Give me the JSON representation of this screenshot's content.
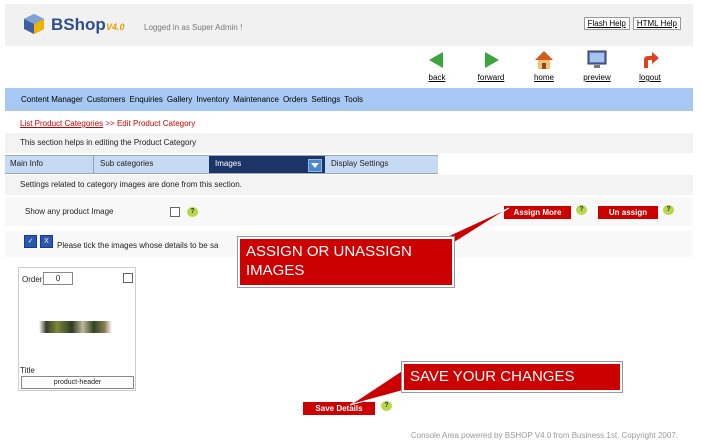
{
  "app": {
    "name": "BShop",
    "version": "V4.0",
    "logged_in": "Logged in as Super Admin !"
  },
  "top_links": [
    "Flash Help",
    "HTML Help"
  ],
  "nav_buttons": [
    {
      "label": "back",
      "icon": "back-arrow-icon"
    },
    {
      "label": "forward",
      "icon": "forward-arrow-icon"
    },
    {
      "label": "home",
      "icon": "home-icon"
    },
    {
      "label": "preview",
      "icon": "preview-monitor-icon"
    },
    {
      "label": "logout",
      "icon": "logout-arrow-icon"
    }
  ],
  "menu": [
    "Content Manager",
    "Customers",
    "Enquiries",
    "Gallery",
    "Inventory",
    "Maintenance",
    "Orders",
    "Settings",
    "Tools"
  ],
  "breadcrumb": {
    "link": "List Product Categories",
    "sep": " >> ",
    "current": "Edit Product Category"
  },
  "section_desc": "This section helps in editing the Product Category",
  "tabs": [
    "Main Info",
    "Sub categories",
    "Images",
    "Display Settings"
  ],
  "active_tab": "Images",
  "info_line": "Settings related to category images are done from this section.",
  "show_any_label": "Show any product Image",
  "help_glyph": "?",
  "buttons": {
    "assign_more": "Assign More",
    "unassign": "Un assign",
    "save_details": "Save Details",
    "check_all": "✓",
    "uncheck_all": "X"
  },
  "tick_text": "Please tick the images whose details to be sa",
  "image_card": {
    "order_label": "Order",
    "order_value": "0",
    "title_label": "Title",
    "title_value": "product-header"
  },
  "callouts": {
    "assign": "ASSIGN OR UNASSIGN IMAGES",
    "save": "SAVE YOUR CHANGES"
  },
  "footer": "Console Area powered by BSHOP V4.0 from Business 1st. Copyright 2007.",
  "colors": {
    "accent_red": "#cc0000",
    "menu_blue": "#a7c8f2",
    "tab_active": "#1c3568"
  }
}
